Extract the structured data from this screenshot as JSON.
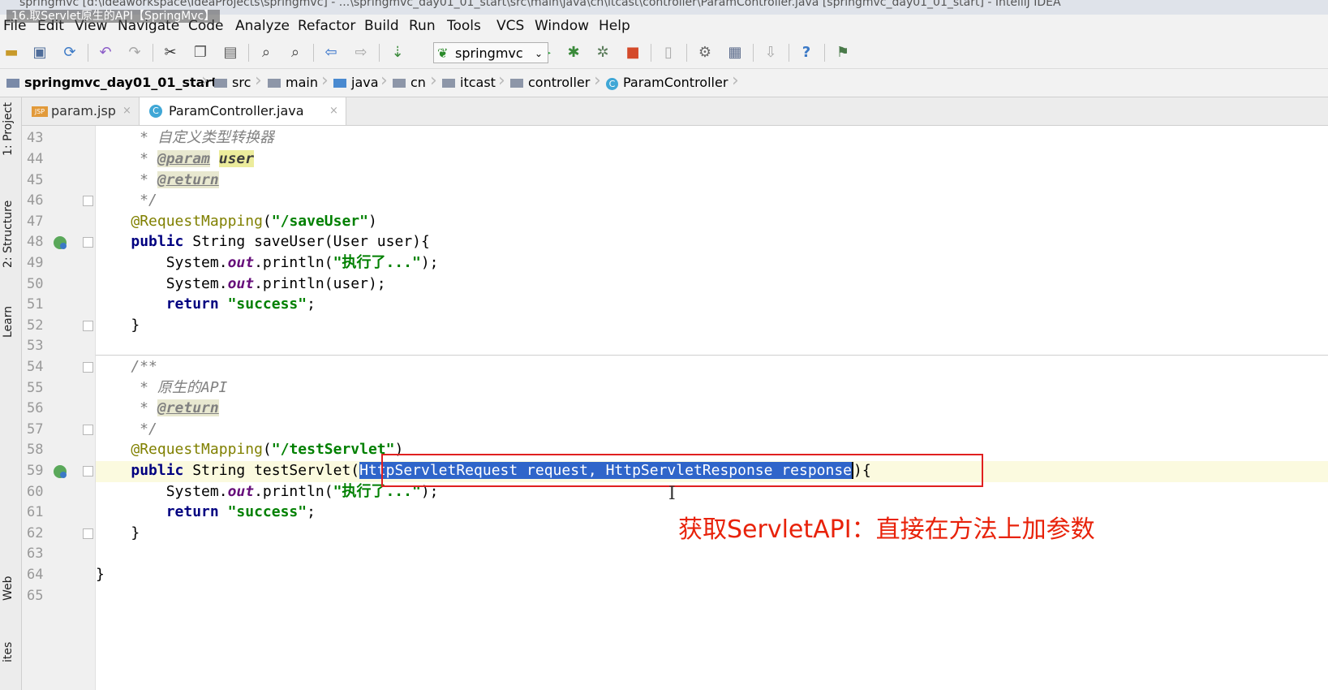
{
  "window": {
    "title": "springmvc [d:\\ideaworkspace\\IdeaProjects\\springmvc] - ...\\springmvc_day01_01_start\\src\\main\\java\\cn\\itcast\\controller\\ParamController.java [springmvc_day01_01_start] - IntelliJ IDEA",
    "video_title": "16.取Servlet原生的API【SpringMvc】"
  },
  "menu": [
    "File",
    "Edit",
    "View",
    "Navigate",
    "Code",
    "Analyze",
    "Refactor",
    "Build",
    "Run",
    "Tools",
    "VCS",
    "Window",
    "Help"
  ],
  "toolbar": {
    "run_config": "springmvc"
  },
  "breadcrumb": [
    "springmvc_day01_01_start",
    "src",
    "main",
    "java",
    "cn",
    "itcast",
    "controller",
    "ParamController"
  ],
  "side_tabs": [
    "1: Project",
    "2: Structure",
    "Learn",
    "Web",
    "ites"
  ],
  "editor_tabs": [
    {
      "label": "param.jsp",
      "badge": "JSP"
    },
    {
      "label": "ParamController.java",
      "badge": "C"
    }
  ],
  "line_numbers": [
    "43",
    "44",
    "45",
    "46",
    "47",
    "48",
    "49",
    "50",
    "51",
    "52",
    "53",
    "54",
    "55",
    "56",
    "57",
    "58",
    "59",
    "60",
    "61",
    "62",
    "63",
    "64",
    "65"
  ],
  "code": {
    "l43": {
      "c0": "     * ",
      "c1": "自定义类型转换器"
    },
    "l44": {
      "c0": "     * ",
      "c1": "@param",
      "c2": " ",
      "c3": "user"
    },
    "l45": {
      "c0": "     * ",
      "c1": "@return"
    },
    "l46": {
      "c0": "     */"
    },
    "l47": {
      "c0": "    ",
      "c1": "@RequestMapping",
      "c2": "(",
      "c3": "\"/saveUser\"",
      "c4": ")"
    },
    "l48": {
      "c0": "    ",
      "c1": "public",
      "c2": " String saveUser(User user){"
    },
    "l49": {
      "c0": "        System.",
      "c1": "out",
      "c2": ".println(",
      "c3": "\"执行了...\"",
      "c4": ");"
    },
    "l50": {
      "c0": "        System.",
      "c1": "out",
      "c2": ".println(user);"
    },
    "l51": {
      "c0": "        ",
      "c1": "return",
      "c2": " ",
      "c3": "\"success\"",
      "c4": ";"
    },
    "l52": {
      "c0": "    }"
    },
    "l54": {
      "c0": "    /**"
    },
    "l55": {
      "c0": "     * ",
      "c1": "原生的API"
    },
    "l56": {
      "c0": "     * ",
      "c1": "@return"
    },
    "l57": {
      "c0": "     */"
    },
    "l58": {
      "c0": "    ",
      "c1": "@RequestMapping",
      "c2": "(",
      "c3": "\"/testServlet\"",
      "c4": ")"
    },
    "l59": {
      "c0": "    ",
      "c1": "public",
      "c2": " String testServlet(",
      "c3": "HttpServletRequest request, HttpServletResponse response",
      "c4": "){"
    },
    "l60": {
      "c0": "        System.",
      "c1": "out",
      "c2": ".println(",
      "c3": "\"执行了...\"",
      "c4": ");"
    },
    "l61": {
      "c0": "        ",
      "c1": "return",
      "c2": " ",
      "c3": "\"success\"",
      "c4": ";"
    },
    "l62": {
      "c0": "    }"
    },
    "l64": {
      "c0": "}"
    }
  },
  "annotation_note": "获取ServletAPI：直接在方法上加参数",
  "colors": {
    "keyword": "#000080",
    "annotation": "#808000",
    "string": "#008000",
    "selection": "#2f65ca",
    "note": "#e8220a"
  }
}
